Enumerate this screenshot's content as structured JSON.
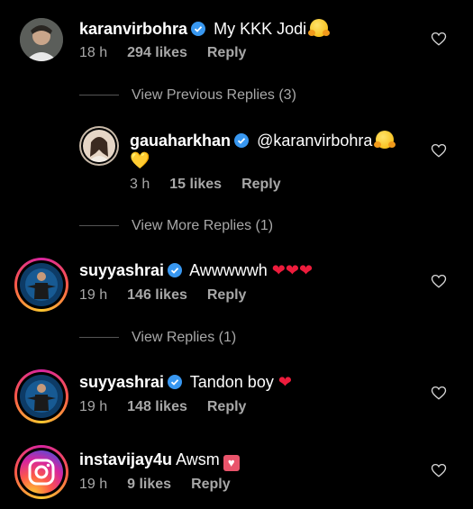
{
  "comments": [
    {
      "username": "karanvirbohra",
      "text": "My KKK Jodi",
      "emoji": "hug",
      "time": "18 h",
      "likes": "294 likes",
      "reply": "Reply"
    },
    {
      "username": "gauaharkhan",
      "text": "@karanvirbohra",
      "emoji": "hug",
      "emoji2": "💛",
      "time": "3 h",
      "likes": "15 likes",
      "reply": "Reply"
    },
    {
      "username": "suyyashrai",
      "text": "Awwwwwh",
      "emoji": "❤❤❤",
      "time": "19 h",
      "likes": "146 likes",
      "reply": "Reply"
    },
    {
      "username": "suyyashrai",
      "text": "Tandon boy",
      "emoji": "❤",
      "time": "19 h",
      "likes": "148 likes",
      "reply": "Reply"
    },
    {
      "username": "instavijay4u",
      "text": "Awsm",
      "emoji": "♥",
      "time": "19 h",
      "likes": "9 likes",
      "reply": "Reply"
    }
  ],
  "view_previous": "View Previous Replies (3)",
  "view_more": "View More Replies (1)",
  "view_replies": "View Replies (1)",
  "colors": {
    "verified": "#3897f0",
    "muted": "#a8a8a8",
    "heart": "#ed1c3c"
  }
}
